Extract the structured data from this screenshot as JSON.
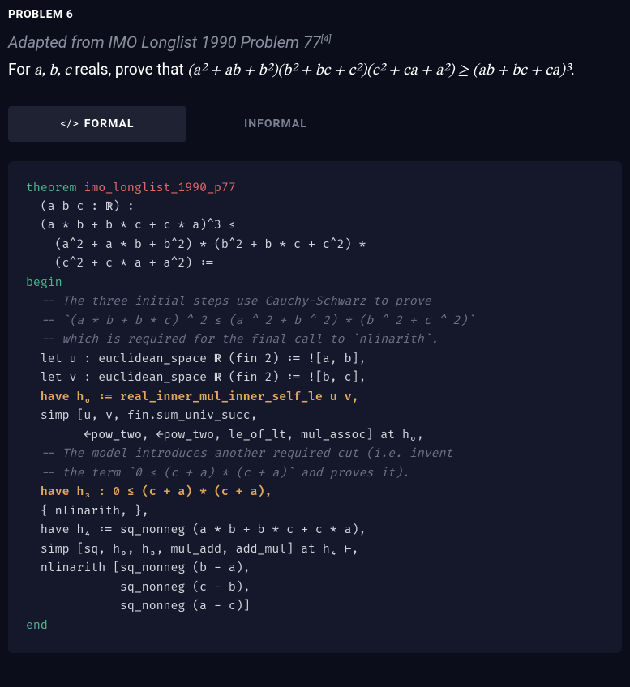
{
  "heading": "PROBLEM 6",
  "source_prefix": "Adapted from IMO Longlist 1990 Problem 77",
  "source_cite": "[4]",
  "statement_pre": "For ",
  "statement_vars": "a, b, c",
  "statement_mid": " reals, prove that ",
  "statement_math": "(a² + ab + b²)(b² + bc + c²)(c² + ca + a²) ≥ (ab + bc + ca)³",
  "statement_post": ".",
  "tabs": {
    "formal_icon": "</>",
    "formal": "FORMAL",
    "informal": "INFORMAL"
  },
  "code": {
    "l01a": "theorem",
    "l01b": " imo_longlist_1990_p77",
    "l02": "  (a b c : ℝ) :",
    "l03": "  (a * b + b * c + c * a)^3 ≤",
    "l04": "    (a^2 + a * b + b^2) * (b^2 + b * c + c^2) *",
    "l05": "    (c^2 + c * a + a^2) :=",
    "l06": "begin",
    "l07": "  -- The three initial steps use Cauchy-Schwarz to prove",
    "l08": "  -- `(a * b + b * c) ^ 2 ≤ (a ^ 2 + b ^ 2) * (b ^ 2 + c ^ 2)`",
    "l09": "  -- which is required for the final call to `nlinarith`.",
    "l10": "  let u : euclidean_space ℝ (fin 2) := ![a, b],",
    "l11": "  let v : euclidean_space ℝ (fin 2) := ![b, c],",
    "l12": "  have h₀ := real_inner_mul_inner_self_le u v,",
    "l13": "  simp [u, v, fin.sum_univ_succ,",
    "l14": "        ←pow_two, ←pow_two, le_of_lt, mul_assoc] at h₀,",
    "l15": "  -- The model introduces another required cut (i.e. invent",
    "l16": "  -- the term `0 ≤ (c + a) * (c + a)` and proves it).",
    "l17": "  have h₃ : 0 ≤ (c + a) * (c + a),",
    "l18": "  { nlinarith, },",
    "l19": "  have h₄ := sq_nonneg (a * b + b * c + c * a),",
    "l20": "  simp [sq, h₀, h₃, mul_add, add_mul] at h₄ ⊢,",
    "l21": "  nlinarith [sq_nonneg (b - a),",
    "l22": "             sq_nonneg (c - b),",
    "l23": "             sq_nonneg (a - c)]",
    "l24": "end"
  }
}
